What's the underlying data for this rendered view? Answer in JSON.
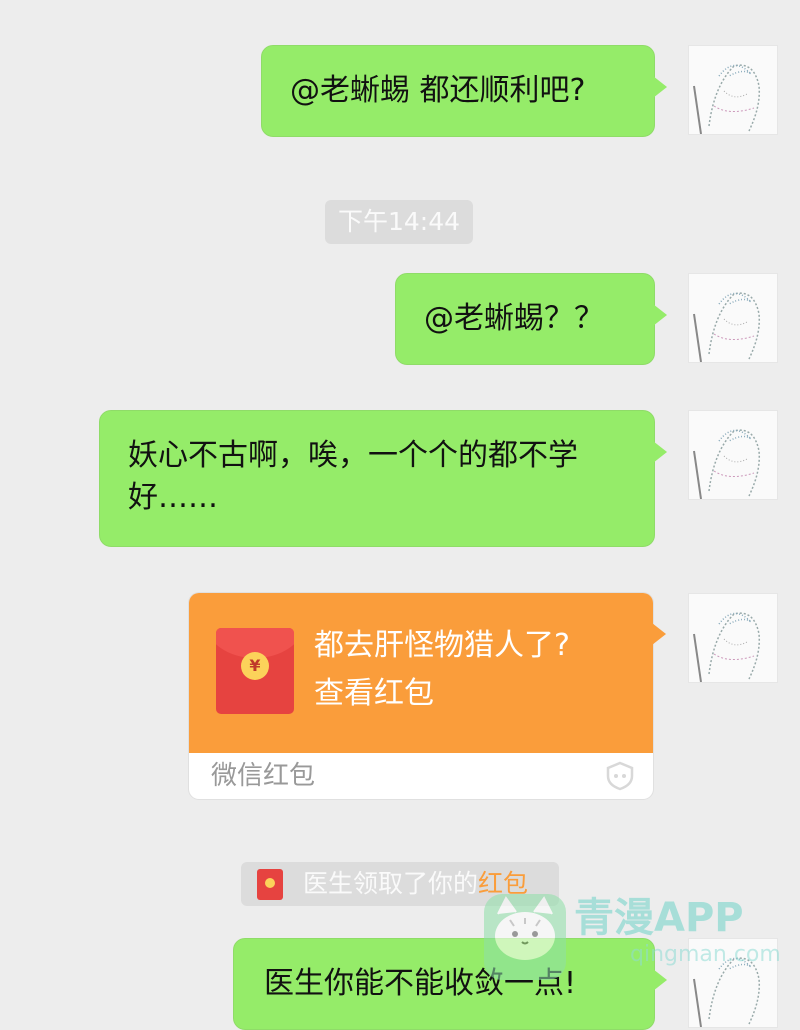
{
  "messages": [
    {
      "text": "@老蜥蜴 都还顺利吧?"
    },
    {
      "text": "@老蜥蜴？？"
    },
    {
      "text": "妖心不古啊，唉，一个个的都不学好……"
    },
    {
      "text": "医生你能不能收敛一点!"
    }
  ],
  "timestamp": "下午14:44",
  "red_packet": {
    "title": "都去肝怪物猎人了?",
    "action": "查看红包",
    "brand": "微信红包",
    "coin_symbol": "¥"
  },
  "notice": {
    "text": "医生领取了你的",
    "link": "红包"
  },
  "watermark": {
    "text": "青漫APP",
    "sub": "qingman.com"
  },
  "icons": {
    "avatar": "sketch-avatar-icon",
    "red_packet": "red-envelope-icon",
    "shield": "shield-icon",
    "watermark": "cat-logo-icon"
  },
  "colors": {
    "background": "#ededed",
    "bubble_green": "#95ec69",
    "red_packet_orange": "#fa9d3b",
    "envelope_red": "#e64340"
  }
}
